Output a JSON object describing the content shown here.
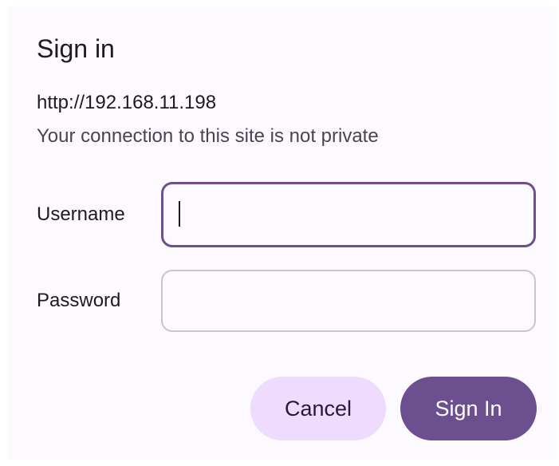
{
  "dialog": {
    "title": "Sign in",
    "url": "http://192.168.11.198",
    "warning": "Your connection to this site is not private"
  },
  "form": {
    "username_label": "Username",
    "username_value": "",
    "password_label": "Password",
    "password_value": ""
  },
  "actions": {
    "cancel_label": "Cancel",
    "signin_label": "Sign In"
  },
  "colors": {
    "accent": "#6c4f8e",
    "cancel_bg": "#efdbfd",
    "dialog_bg": "#fcfaff"
  }
}
